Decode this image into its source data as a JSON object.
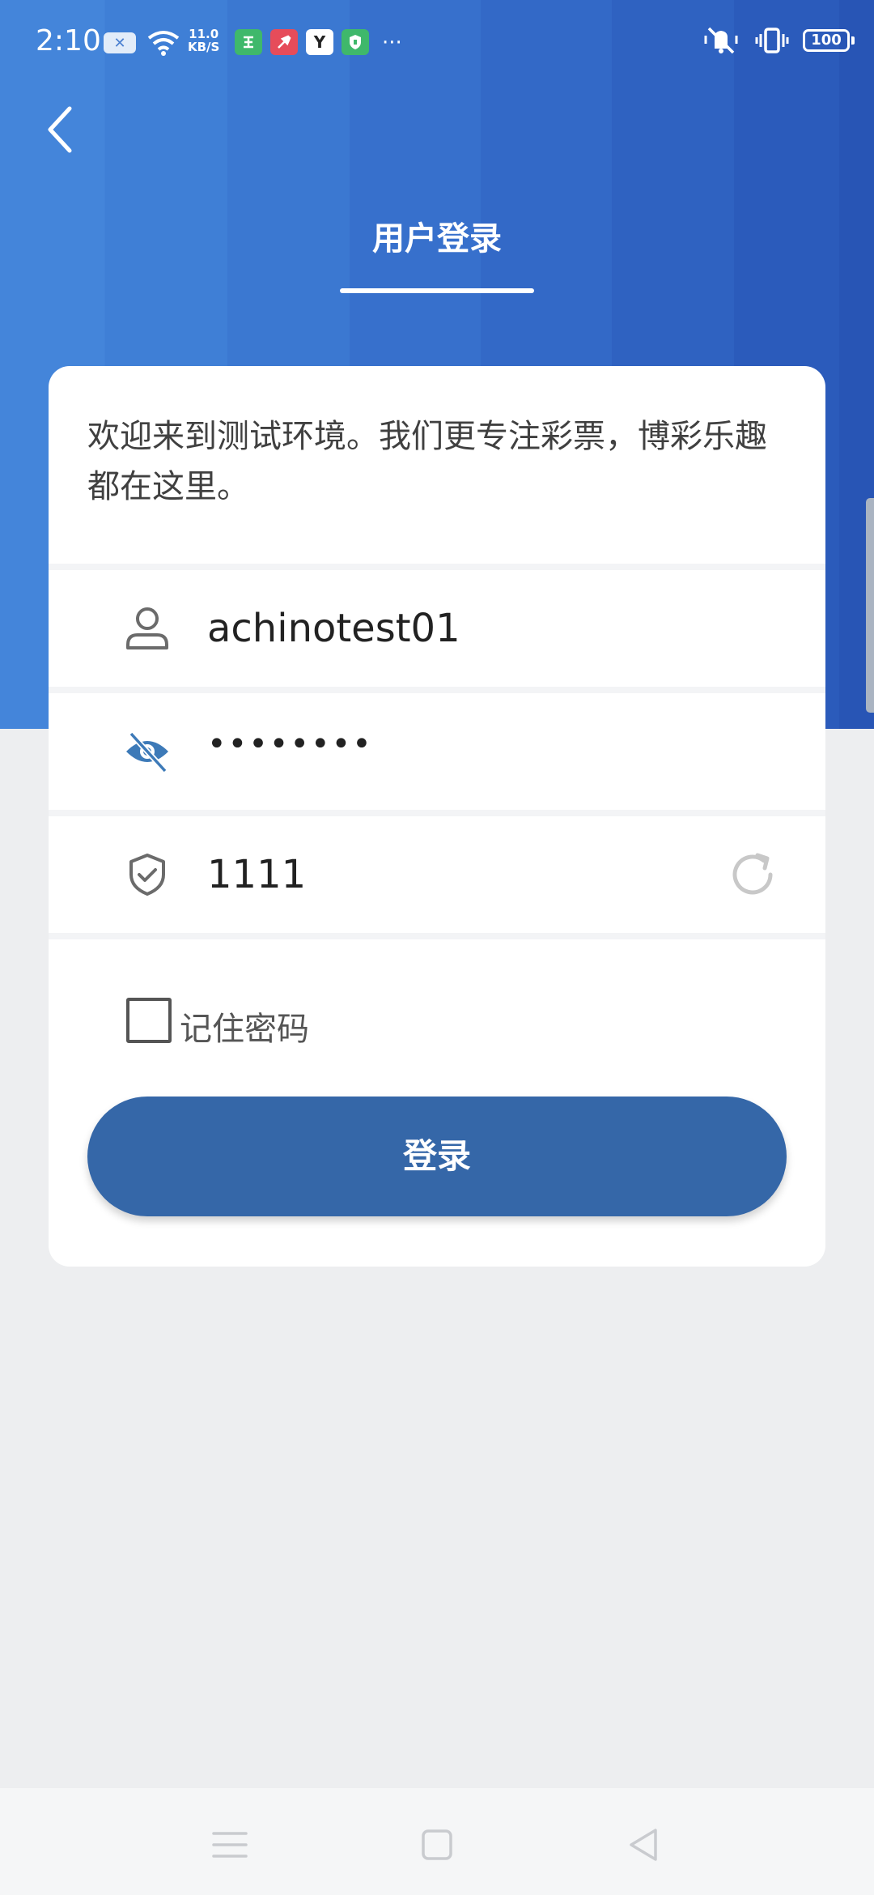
{
  "status_bar": {
    "time": "2:10",
    "net_speed_value": "11.0",
    "net_speed_unit": "KB/S",
    "more": "···",
    "battery": "100",
    "icons": [
      "sim-icon",
      "wifi-icon",
      "app-icon-green",
      "app-icon-red",
      "app-icon-y",
      "shield-app-icon",
      "mute-icon",
      "vibrate-icon"
    ],
    "app_y_label": "Y"
  },
  "header": {
    "back_icon": "chevron-left-icon",
    "title": "用户登录"
  },
  "card": {
    "welcome_text": "欢迎来到测试环境。我们更专注彩票，博彩乐趣都在这里。",
    "username": {
      "icon": "user-icon",
      "value": "achinotest01"
    },
    "password": {
      "icon": "eye-off-icon",
      "value": "••••••••"
    },
    "captcha": {
      "icon": "shield-check-icon",
      "value": "1111",
      "refresh_icon": "refresh-icon"
    },
    "remember_label": "记住密码",
    "login_label": "登录"
  },
  "colors": {
    "accent": "#3567a8",
    "header_start": "#4485da",
    "header_end": "#2855b5",
    "background": "#edeef0"
  },
  "nav_bar": {
    "items": [
      "menu-icon",
      "home-icon",
      "back-triangle-icon"
    ]
  }
}
